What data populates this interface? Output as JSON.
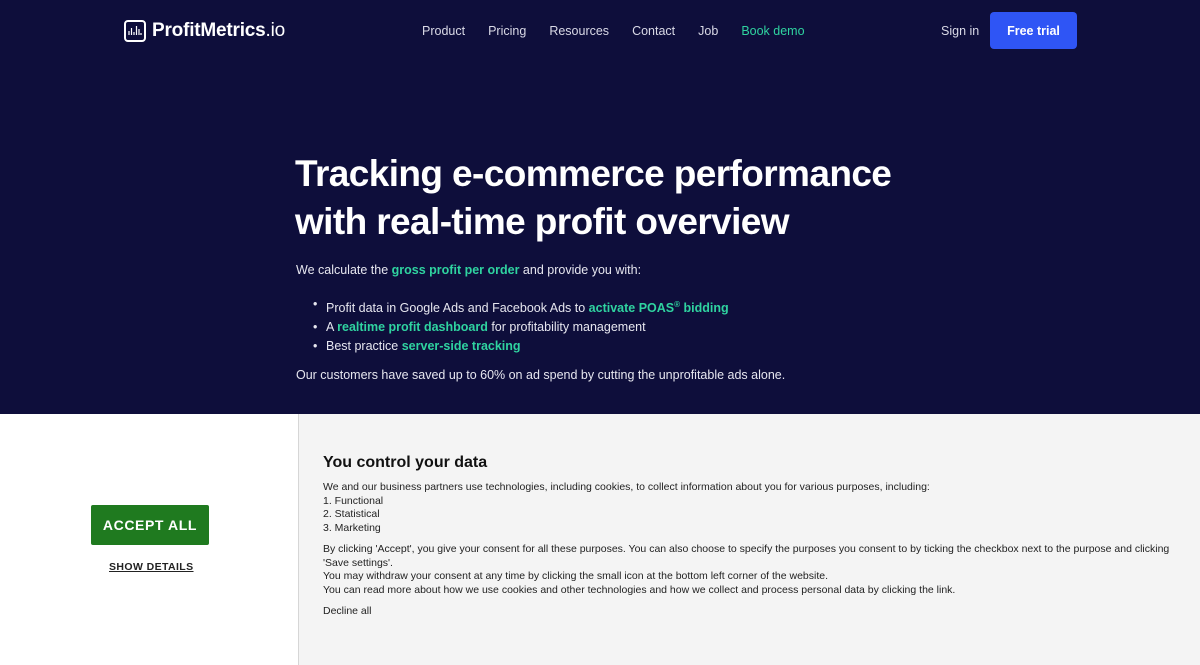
{
  "header": {
    "logo_text": "ProfitMetrics",
    "logo_tld": ".io",
    "nav": [
      {
        "label": "Product"
      },
      {
        "label": "Pricing"
      },
      {
        "label": "Resources"
      },
      {
        "label": "Contact"
      },
      {
        "label": "Job"
      },
      {
        "label": "Book demo"
      }
    ],
    "sign_in": "Sign in",
    "free_trial": "Free trial"
  },
  "hero": {
    "headline_line1": "Tracking e-commerce performance",
    "headline_line2": "with real-time profit overview",
    "intro_prefix": "We calculate the ",
    "intro_link": "gross profit per order",
    "intro_suffix": " and provide you with:",
    "bullets": [
      {
        "prefix": "Profit data in Google Ads and Facebook Ads to ",
        "link": "activate POAS",
        "sup": "®",
        "link_after": " bidding",
        "suffix": ""
      },
      {
        "prefix": "A ",
        "link": "realtime profit dashboard",
        "sup": "",
        "link_after": "",
        "suffix": " for profitability management"
      },
      {
        "prefix": "Best practice ",
        "link": "server-side tracking",
        "sup": "",
        "link_after": "",
        "suffix": ""
      }
    ],
    "savings": "Our customers have saved up to 60% on ad spend by cutting the unprofitable ads alone."
  },
  "consent": {
    "accept_all": "ACCEPT ALL",
    "show_details": "SHOW DETAILS",
    "title": "You control your data",
    "intro": "We and our business partners use technologies, including cookies, to collect information about you for various purposes, including:",
    "purposes": [
      "1. Functional",
      "2. Statistical",
      "3. Marketing"
    ],
    "para1": "By clicking 'Accept', you give your consent for all these purposes. You can also choose to specify the purposes you consent to by ticking the checkbox next to the purpose and clicking 'Save settings'.",
    "para2": "You may withdraw your consent at any time by clicking the small icon at the bottom left corner of the website.",
    "para3": "You can read more about how we use cookies and other technologies and how we collect and process personal data by clicking the link.",
    "decline": "Decline all"
  },
  "colors": {
    "hero_bg": "#0e0e3b",
    "accent_green": "#2fd3a0",
    "cta_blue": "#2f55f5",
    "accept_green": "#1f7a1f"
  }
}
